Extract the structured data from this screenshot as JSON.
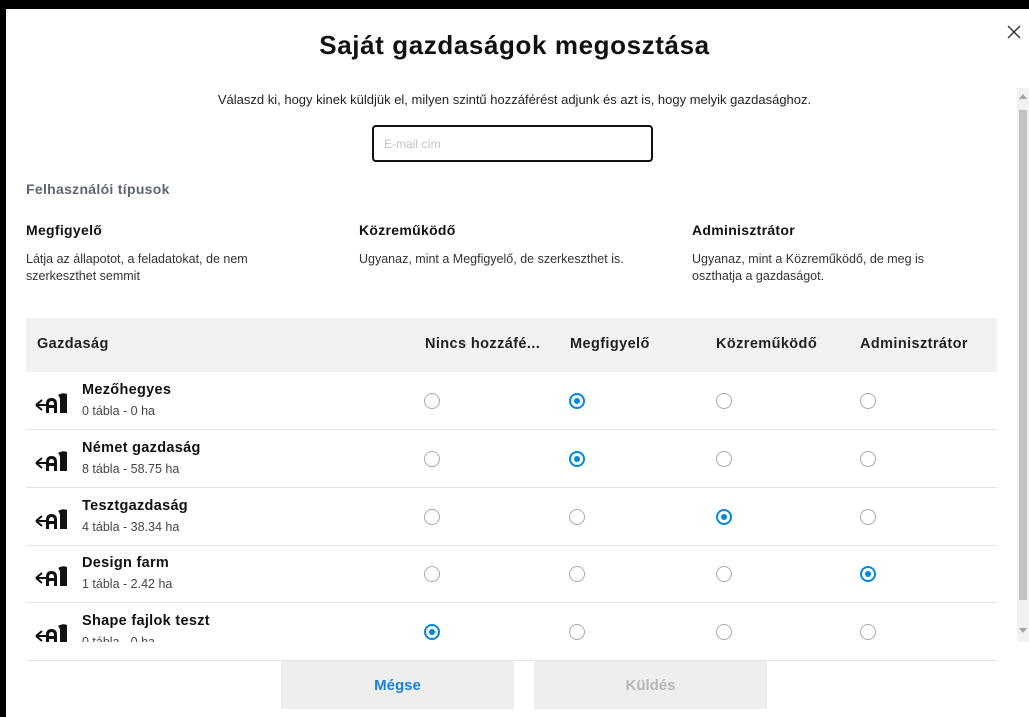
{
  "dialog": {
    "title": "Saját gazdaságok megosztása",
    "subtitle": "Válaszd ki, hogy kinek küldjük el, milyen szintű hozzáférést adjunk és azt is, hogy melyik gazdasághoz.",
    "email_placeholder": "E-mail cím",
    "email_value": ""
  },
  "user_types": {
    "label": "Felhasználói típusok",
    "roles": [
      {
        "name": "Megfigyelő",
        "description_lines": [
          "Látja az állapotot, a feladatokat, de nem",
          "szerkeszthet semmit"
        ]
      },
      {
        "name": "Közreműködő",
        "description_lines": [
          "Ugyanaz, mint a Megfigyelő, de szerkeszthet is.",
          ""
        ]
      },
      {
        "name": "Adminisztrátor",
        "description_lines": [
          "Ugyanaz, mint a Közreműködő, de meg is",
          "oszthatja a gazdaságot."
        ]
      }
    ]
  },
  "table": {
    "headers": [
      "Gazdaság",
      "Nincs hozzáfé...",
      "Megfigyelő",
      "Közreműködő",
      "Adminisztrátor"
    ],
    "rows": [
      {
        "name": "Mezőhegyes",
        "details": "0 tábla - 0 ha",
        "selected_access": "Megfigyelő"
      },
      {
        "name": "Német gazdaság",
        "details": "8 tábla - 58.75 ha",
        "selected_access": "Megfigyelő"
      },
      {
        "name": "Tesztgazdaság",
        "details": "4 tábla - 38.34 ha",
        "selected_access": "Közreműködő"
      },
      {
        "name": "Design farm",
        "details": "1 tábla - 2.42 ha",
        "selected_access": "Adminisztrátor"
      },
      {
        "name": "Shape fajlok teszt",
        "details": "0 tábla - 0 ha",
        "selected_access": "Nincs hozzáfé..."
      }
    ]
  },
  "buttons": {
    "cancel": "Mégse",
    "send": "Küldés"
  },
  "icons": {
    "close": "close-icon",
    "farm": "farm-share-icon"
  },
  "colors": {
    "accent": "#0088e0",
    "cancel_text": "#1a7fd8",
    "disabled_text": "#b7b7b7",
    "header_bg": "#f2f2f2",
    "button_bg": "#eeeeee"
  }
}
